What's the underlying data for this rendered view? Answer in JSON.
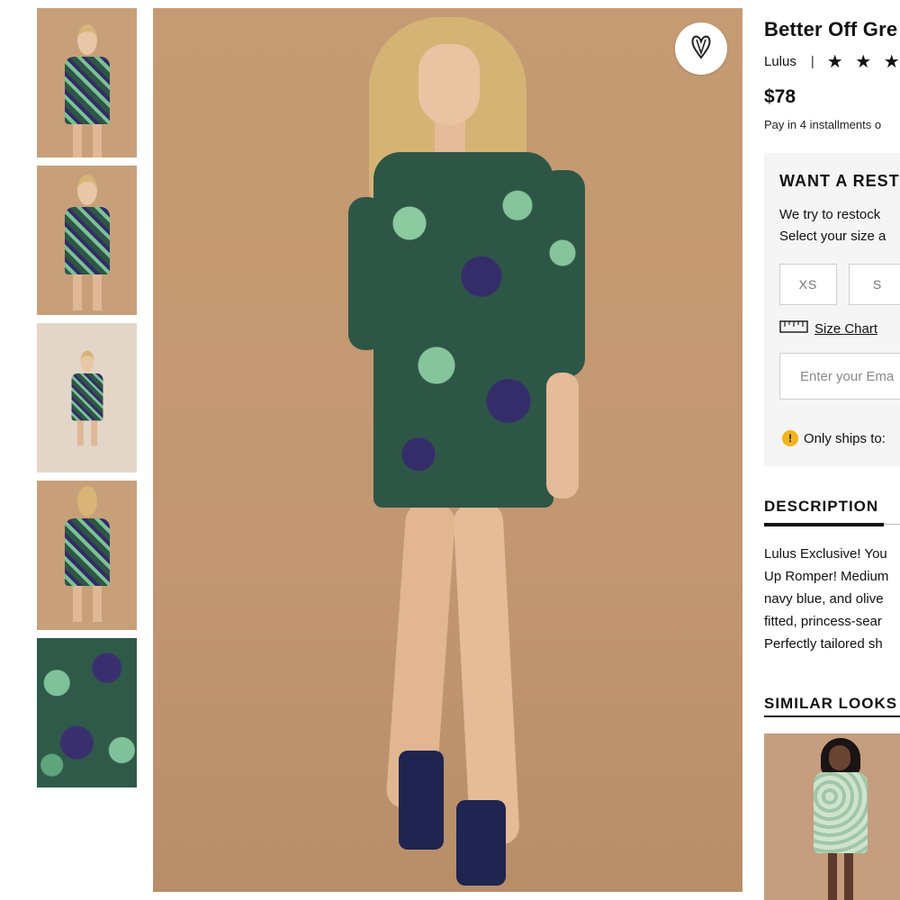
{
  "product": {
    "title": "Better Off Gre",
    "brand": "Lulus",
    "separator": "|",
    "stars": "★ ★ ★",
    "price": "$78",
    "installments": "Pay in 4 installments o"
  },
  "thumbnails": [
    {
      "label": "front view"
    },
    {
      "label": "front pose"
    },
    {
      "label": "full length"
    },
    {
      "label": "back view"
    },
    {
      "label": "fabric detail"
    }
  ],
  "restock": {
    "title": "WANT A REST",
    "line1": "We try to restock",
    "line2": "Select your size a",
    "sizes": [
      "XS",
      "S"
    ],
    "size_chart_label": "Size Chart",
    "email_placeholder": "Enter your Ema",
    "ships_text": "Only ships to:",
    "warn_symbol": "!"
  },
  "description": {
    "tab_label": "DESCRIPTION",
    "lines": [
      "Lulus Exclusive! You",
      "Up Romper! Medium",
      "navy blue, and olive",
      "fitted, princess-sear",
      "Perfectly tailored sh"
    ]
  },
  "similar": {
    "title": "SIMILAR LOOKS"
  },
  "icons": {
    "favorite": "heart-v-icon",
    "size_chart": "ruler-icon",
    "warning": "warning-icon"
  },
  "colors": {
    "backdrop": "#c59b73",
    "panel": "#f5f5f5",
    "warning": "#f1b51c"
  }
}
